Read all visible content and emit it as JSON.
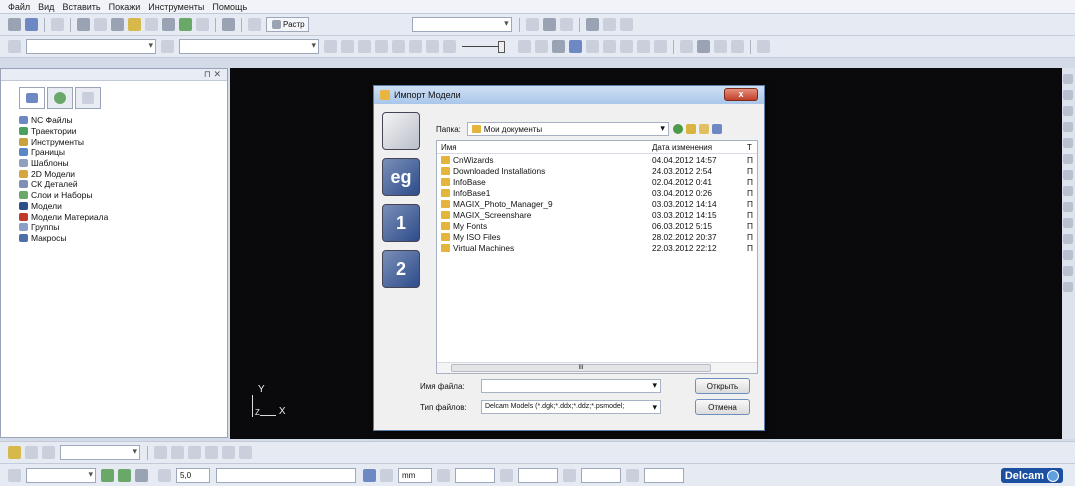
{
  "menu": [
    "Файл",
    "Вид",
    "Вставить",
    "Покажи",
    "Инструменты",
    "Помощь"
  ],
  "toolbar": {
    "raster_label": "Растр"
  },
  "tree": [
    {
      "label": "NC Файлы",
      "color": "#6d88c2"
    },
    {
      "label": "Траектории",
      "color": "#4aa060"
    },
    {
      "label": "Инструменты",
      "color": "#c9a23c"
    },
    {
      "label": "Границы",
      "color": "#5b86c5"
    },
    {
      "label": "Шаблоны",
      "color": "#8fa0bf"
    },
    {
      "label": "2D Модели",
      "color": "#d5a640"
    },
    {
      "label": "СК Деталей",
      "color": "#7d8fb5"
    },
    {
      "label": "Слои и Наборы",
      "color": "#6aa86a"
    },
    {
      "label": "Модели",
      "color": "#2f4d8a"
    },
    {
      "label": "Модели Материала",
      "color": "#c0392b"
    },
    {
      "label": "Группы",
      "color": "#8aa0c8"
    },
    {
      "label": "Макросы",
      "color": "#4f6ea8"
    }
  ],
  "viewport": {
    "axis_y": "Y",
    "axis_z": "Z",
    "axis_x": "X"
  },
  "dialog": {
    "title": "Импорт Модели",
    "close_label": "x",
    "places": [
      "",
      "eg",
      "1",
      "2"
    ],
    "folder_label": "Папка:",
    "folder_value": "Мои документы",
    "col_name": "Имя",
    "col_date": "Дата изменения",
    "col_type": "Т",
    "files": [
      {
        "name": "CnWizards",
        "date": "04.04.2012 14:57",
        "type": "П"
      },
      {
        "name": "Downloaded Installations",
        "date": "24.03.2012 2:54",
        "type": "П"
      },
      {
        "name": "InfoBase",
        "date": "02.04.2012 0:41",
        "type": "П"
      },
      {
        "name": "InfoBase1",
        "date": "03.04.2012 0:26",
        "type": "П"
      },
      {
        "name": "MAGIX_Photo_Manager_9",
        "date": "03.03.2012 14:14",
        "type": "П"
      },
      {
        "name": "MAGIX_Screenshare",
        "date": "03.03.2012 14:15",
        "type": "П"
      },
      {
        "name": "My Fonts",
        "date": "06.03.2012 5:15",
        "type": "П"
      },
      {
        "name": "My ISO Files",
        "date": "28.02.2012 20:37",
        "type": "П"
      },
      {
        "name": "Virtual Machines",
        "date": "22.03.2012 22:12",
        "type": "П"
      }
    ],
    "scroll_thumb": "III",
    "filename_label": "Имя файла:",
    "filename_value": "",
    "filetype_label": "Тип файлов:",
    "filetype_value": "Delcam Models (*.dgk;*.ddx;*.ddz;*.psmodel;",
    "open_label": "Открыть",
    "cancel_label": "Отмена"
  },
  "status": {
    "value": "5,0",
    "unit": "mm",
    "brand": "Delcam"
  }
}
